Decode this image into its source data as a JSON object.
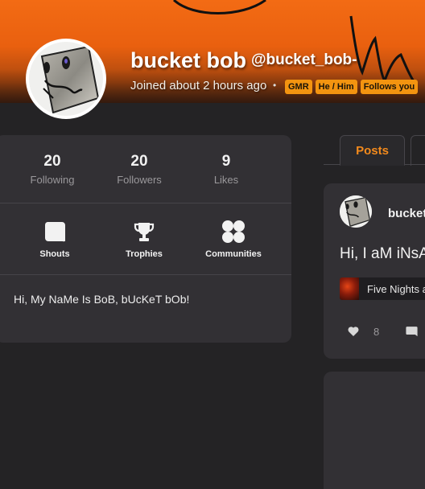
{
  "profile": {
    "display_name": "bucket bob",
    "handle": "@bucket_bob-",
    "joined": "Joined about 2 hours ago",
    "separator": "•",
    "badges": [
      "GMR",
      "He / Him",
      "Follows you"
    ]
  },
  "stats": {
    "following": {
      "value": "20",
      "label": "Following"
    },
    "followers": {
      "value": "20",
      "label": "Followers"
    },
    "likes": {
      "value": "9",
      "label": "Likes"
    }
  },
  "actions": {
    "shouts": "Shouts",
    "trophies": "Trophies",
    "communities": "Communities"
  },
  "bio": "Hi, My NaMe Is BoB, bUcKeT bOb!",
  "tabs": {
    "posts": "Posts"
  },
  "post": {
    "author": "bucket",
    "text": "Hi, I aM iNsA",
    "game": "Five Nights a",
    "like_count": "8"
  },
  "colors": {
    "accent": "#f38a1c",
    "badge": "#f39410",
    "banner": "#f36b14",
    "background": "#242325",
    "card": "#323034"
  },
  "icons": [
    "shout-icon",
    "trophy-icon",
    "communities-icon",
    "heart-icon",
    "comment-icon"
  ]
}
